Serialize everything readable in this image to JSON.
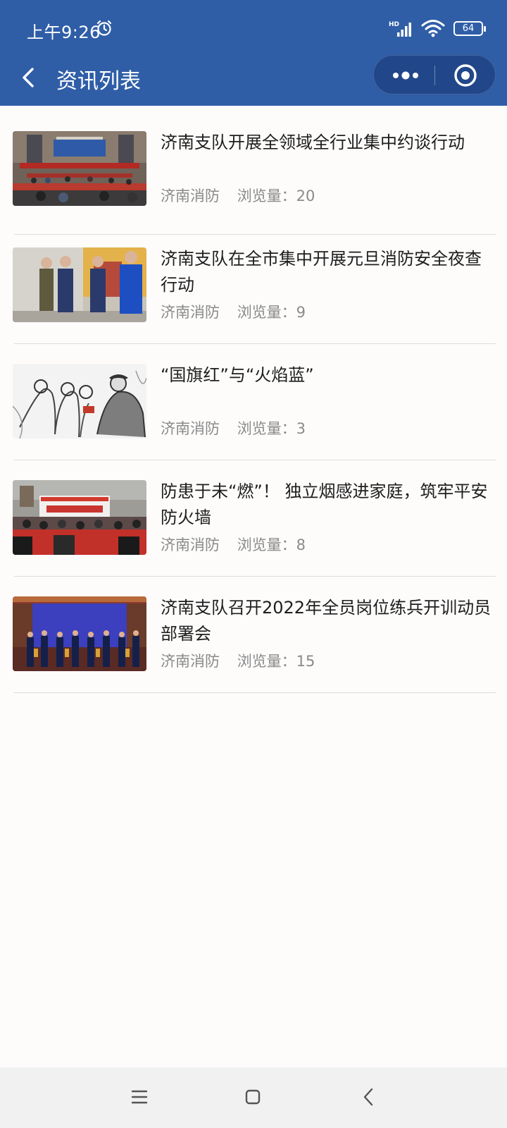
{
  "status_bar": {
    "time": "上午9:26",
    "battery": "64",
    "network_label": "HD"
  },
  "nav": {
    "title": "资讯列表"
  },
  "news": [
    {
      "title": "济南支队开展全领域全行业集中约谈行动",
      "source": "济南消防",
      "views_label": "浏览量：20",
      "views": 20
    },
    {
      "title": "济南支队在全市集中开展元旦消防安全夜查行动",
      "source": "济南消防",
      "views_label": "浏览量：9",
      "views": 9
    },
    {
      "title": "“国旗红”与“火焰蓝”",
      "source": "济南消防",
      "views_label": "浏览量：3",
      "views": 3
    },
    {
      "title": "防患于未“燃”！ 独立烟感进家庭，筑牢平安防火墙",
      "source": "济南消防",
      "views_label": "浏览量：8",
      "views": 8
    },
    {
      "title": "济南支队召开2022年全员岗位练兵开训动员部署会",
      "source": "济南消防",
      "views_label": "浏览量：15",
      "views": 15
    }
  ],
  "colors": {
    "header": "#2f5ea7",
    "capsule": "#21478a",
    "title_text": "#1e1e1e",
    "meta_text": "#8a8a8a"
  }
}
